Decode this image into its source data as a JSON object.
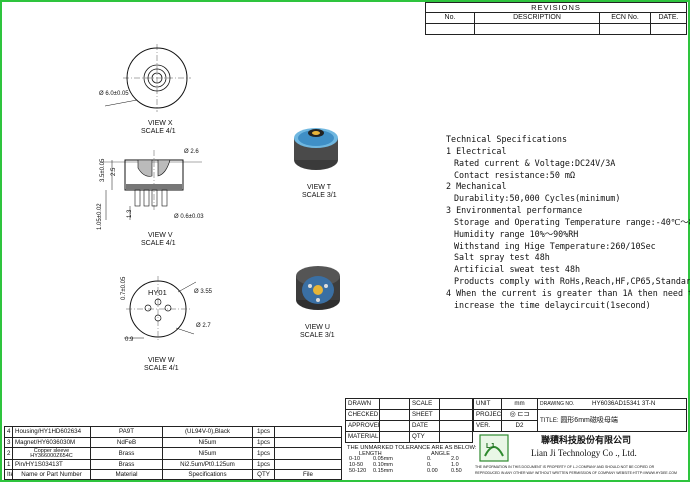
{
  "revisions": {
    "title": "REVISIONS",
    "col_no": "No.",
    "col_desc": "DESCRIPTION",
    "col_ecn": "ECN No.",
    "col_date": "DATE."
  },
  "views": {
    "x": {
      "name": "VIEW X",
      "scale": "SCALE 4/1",
      "dim": "Ø 6.0±0.05"
    },
    "t": {
      "name": "VIEW T",
      "scale": "SCALE 3/1"
    },
    "v": {
      "name": "VIEW V",
      "scale": "SCALE 4/1",
      "dims": [
        "Ø 2.6",
        "3.5±0.05",
        "2.5",
        "1.05±0.02",
        "1.3",
        "Ø 0.6±0.03"
      ]
    },
    "u": {
      "name": "VIEW U",
      "scale": "SCALE 3/1"
    },
    "w": {
      "name": "VIEW W",
      "scale": "SCALE 4/1",
      "dims": [
        "HY01",
        "Ø 3.55",
        "Ø 2.7",
        "0.7±0.05",
        "0.9"
      ]
    }
  },
  "specs": {
    "title": "Technical Specifications",
    "lines": [
      {
        "text": "1 Electrical",
        "indent": false
      },
      {
        "text": "Rated current & Voltage:DC24V/3A",
        "indent": true
      },
      {
        "text": "Contact resistance:50 mΩ",
        "indent": true
      },
      {
        "text": "2 Mechanical",
        "indent": false
      },
      {
        "text": "Durability:50,000 Cycles(minimum)",
        "indent": true
      },
      {
        "text": "3 Environmental performance",
        "indent": false
      },
      {
        "text": "Storage and Operating Temperature range:-40℃～85℃",
        "indent": true
      },
      {
        "text": "Humidity range 10%～90%RH",
        "indent": true
      },
      {
        "text": "Withstand ing Hige Temperature:260/10Sec",
        "indent": true
      },
      {
        "text": "Salt spray test 48h",
        "indent": true
      },
      {
        "text": "Artificial sweat test 48h",
        "indent": true
      },
      {
        "text": "Products comply with RoHs,Reach,HF,CP65,Standards",
        "indent": true
      },
      {
        "text": "4 When the current is greater than 1A then need to",
        "indent": false
      },
      {
        "text": "increase the time delaycircuit(1second)",
        "indent": true
      }
    ]
  },
  "bom": {
    "rows": [
      {
        "no": "4",
        "part": "Housing/HY1HD602634",
        "material": "PA9T",
        "spec": "(UL94V-0),Black",
        "qty": "1pcs"
      },
      {
        "no": "3",
        "part": "Magnet/HY6036030M",
        "material": "NdFeB",
        "spec": "Ni5um",
        "qty": "1pcs"
      },
      {
        "no": "2",
        "part": "Copper sleeve HY366000Z654C",
        "material": "Brass",
        "spec": "Ni5um",
        "qty": "1pcs"
      },
      {
        "no": "1",
        "part": "Pin/HY1S03413T",
        "material": "Brass",
        "spec": "Ni2.5um/Pt0.125um",
        "qty": "1pcs"
      }
    ],
    "header": {
      "no": "Item",
      "part": "Name or Part Number",
      "material": "Material",
      "spec": "Specifications",
      "qty": "QTY",
      "extra": "File"
    }
  },
  "title_block": {
    "drawn": "DRAWN",
    "checked": "CHECKED",
    "approved": "APPROVED",
    "material": "MATERIAL",
    "scale": "SCALE",
    "sheet": "SHEET",
    "date": "DATE",
    "qty": "QTY",
    "unit": "UNIT",
    "unit_val": "mm",
    "drawing_no_label": "DRAWING NO.",
    "drawing_no": "HY6036AD15341 3T-N",
    "projection": "PROJECTION",
    "title_label": "TITLE:",
    "title_val": "圆形6mm磁吸母端",
    "ver": "VER.",
    "ver_val": "D2",
    "tol_title": "THE UNMARKED TOLERANCE ARE AS BELOW:",
    "tol_len": "LENGTH",
    "tol_ang": "ANGLE",
    "tol_rows": [
      [
        "0-10",
        "0.05mm",
        "0.",
        "2.0"
      ],
      [
        "10-50",
        "0.10mm",
        "0.",
        "1.0"
      ],
      [
        "50-120",
        "0.15mm",
        "0.00",
        "0.50"
      ]
    ],
    "company_cn": "聯積科技股份有限公司",
    "company_en": "Lian Ji Technology Co ., Ltd.",
    "logo": "LJ",
    "notice1": "THE INFORMATION IN THIS DOCUMENT IS PROPERTY OF L.J COMPANY AND SHOULD NOT BE COPIED OR",
    "notice2": "REPRODUCED IN ANY OTHER WAY WITHOUT WRITTEN PERMISSION OF COMPANY WEBSITE:HTTP://WWW.HYDEE.COM"
  }
}
